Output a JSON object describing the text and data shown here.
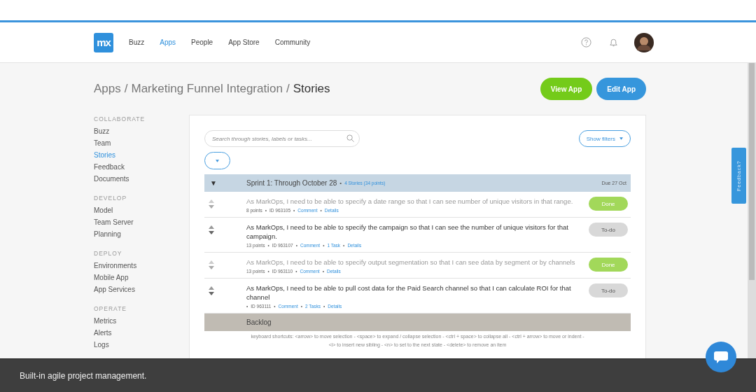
{
  "nav": {
    "logo": "mx",
    "items": [
      {
        "label": "Buzz",
        "selected": false
      },
      {
        "label": "Apps",
        "selected": true
      },
      {
        "label": "People",
        "selected": false
      },
      {
        "label": "App Store",
        "selected": false
      },
      {
        "label": "Community",
        "selected": false
      }
    ]
  },
  "breadcrumb": {
    "parts": [
      "Apps",
      "Marketing Funnel Integration"
    ],
    "separator": "/",
    "current": "Stories"
  },
  "actions": [
    {
      "label": "View App",
      "kind": "view"
    },
    {
      "label": "Edit App",
      "kind": "edit"
    }
  ],
  "sidebar": [
    {
      "heading": "COLLABORATE",
      "items": [
        {
          "label": "Buzz",
          "selected": false
        },
        {
          "label": "Team",
          "selected": false
        },
        {
          "label": "Stories",
          "selected": true
        },
        {
          "label": "Feedback",
          "selected": false
        },
        {
          "label": "Documents",
          "selected": false
        }
      ]
    },
    {
      "heading": "DEVELOP",
      "items": [
        {
          "label": "Model",
          "selected": false
        },
        {
          "label": "Team Server",
          "selected": false
        },
        {
          "label": "Planning",
          "selected": false
        }
      ]
    },
    {
      "heading": "DEPLOY",
      "items": [
        {
          "label": "Environments",
          "selected": false
        },
        {
          "label": "Mobile App",
          "selected": false
        },
        {
          "label": "App Services",
          "selected": false
        }
      ]
    },
    {
      "heading": "OPERATE",
      "items": [
        {
          "label": "Metrics",
          "selected": false
        },
        {
          "label": "Alerts",
          "selected": false
        },
        {
          "label": "Logs",
          "selected": false
        }
      ]
    }
  ],
  "search": {
    "placeholder": "Search through stories, labels or tasks..."
  },
  "filters_button": "Show filters",
  "sprint": {
    "toggle": "▼",
    "title": "Sprint 1: Through October 28",
    "summary": "4 Stories (34 points)",
    "due": "Due 27 Oct",
    "expanded": true
  },
  "stories": [
    {
      "text": "As MarkOps, I need to be able to specify a date range so that I can see number of unique visitors in that range.",
      "meta": [
        "8 points",
        "ID 963105"
      ],
      "links": [
        "Comment",
        "Details"
      ],
      "status": "Done",
      "done": true
    },
    {
      "text": "As MarkOps, I need to be able to specify the campaign so that I can see the number of unique visitors for that campaign.",
      "meta": [
        "13 points",
        "ID 963107"
      ],
      "links": [
        "Comment",
        "1 Task",
        "Details"
      ],
      "status": "To-do",
      "done": false
    },
    {
      "text": "As MarkOps, I need to be able to specify output segmentation so that I can see data by segment or by channels",
      "meta": [
        "13 points",
        "ID 963110"
      ],
      "links": [
        "Comment",
        "Details"
      ],
      "status": "Done",
      "done": true
    },
    {
      "text": "As MarkOps, I need to be able to pull cost data for the Paid Search channel so that I can calculate ROI for that channel",
      "meta": [
        "ID 963111"
      ],
      "links": [
        "Comment",
        "2 Tasks",
        "Details"
      ],
      "status": "To-do",
      "done": false
    }
  ],
  "backlog": "Backlog",
  "separator": "•",
  "shortcuts": [
    "keyboard shortcuts: <arrow> to move selection - <space> to expand / collapse selection - <ctrl + space> to collapse all - <ctrl + arrow> to move or indent -",
    "<i> to insert new sibling - <n> to set to the next state - <delete> to remove an item"
  ],
  "feedback_tab": "Feedback?",
  "caption": "Built-in agile project management."
}
